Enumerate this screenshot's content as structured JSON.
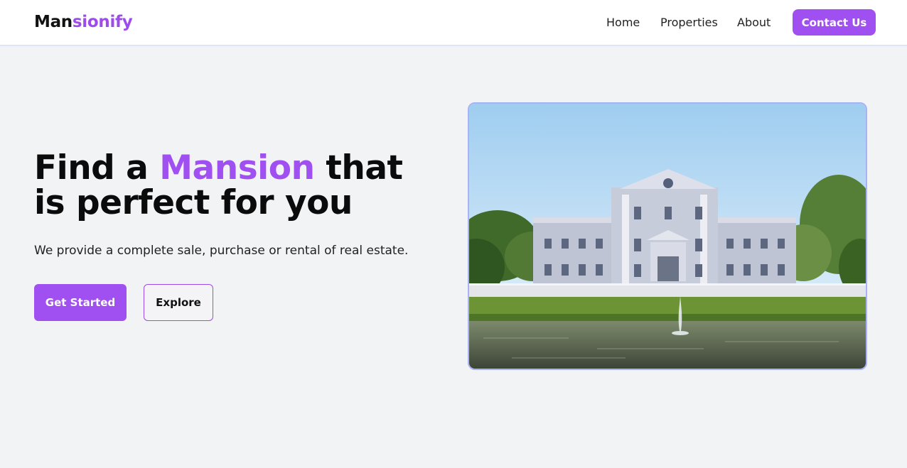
{
  "brand": {
    "prefix": "Man",
    "accent": "sionify"
  },
  "nav": {
    "home": "Home",
    "properties": "Properties",
    "about": "About",
    "contact": "Contact Us"
  },
  "hero": {
    "title_part1": "Find a ",
    "title_accent": "Mansion",
    "title_part2": " that is perfect for you",
    "subtitle": "We provide a complete sale, purchase or rental of real estate.",
    "primary_button": "Get Started",
    "secondary_button": "Explore"
  },
  "colors": {
    "accent": "#a04ff0",
    "background": "#f2f3f5",
    "image_border": "#a9b2f5"
  },
  "icons": {
    "hero_image": "mansion-photo"
  }
}
